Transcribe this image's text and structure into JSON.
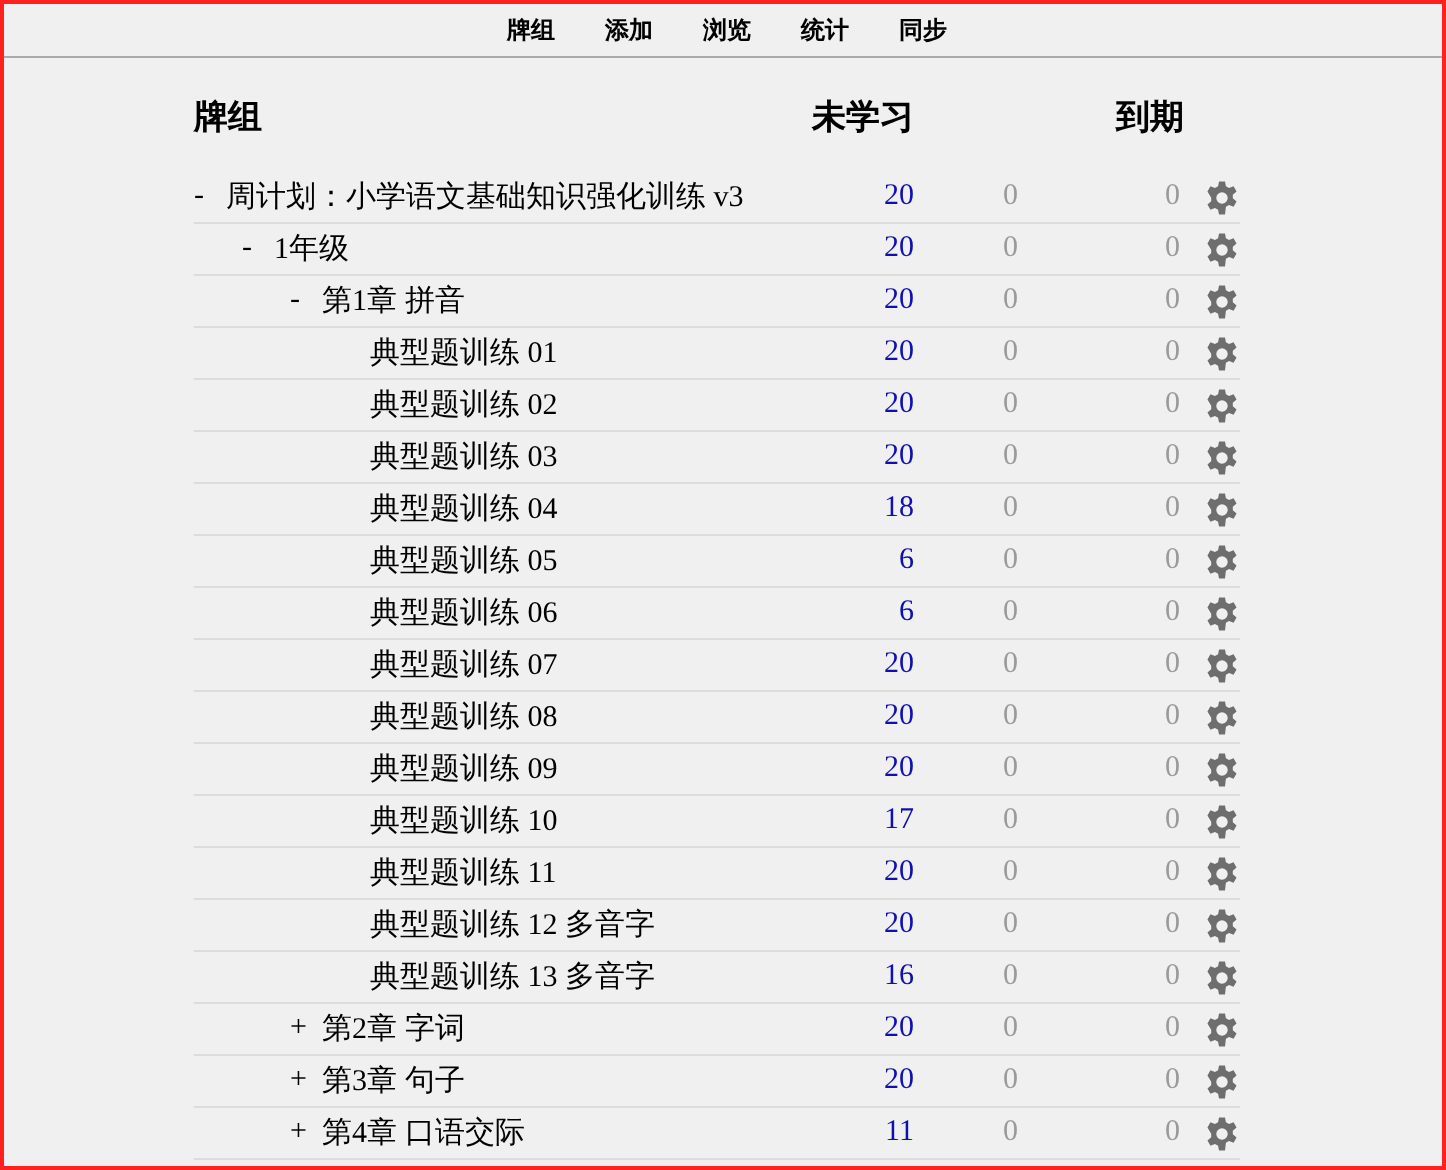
{
  "nav": [
    {
      "label": "牌组"
    },
    {
      "label": "添加"
    },
    {
      "label": "浏览"
    },
    {
      "label": "统计"
    },
    {
      "label": "同步"
    }
  ],
  "columns": {
    "deck": "牌组",
    "new": "未学习",
    "due": "到期"
  },
  "decks": [
    {
      "toggle": "-",
      "name": "周计划：小学语文基础知识强化训练 v3",
      "new": "20",
      "learn": "0",
      "due": "0",
      "children": [
        {
          "toggle": "-",
          "name": "1年级",
          "new": "20",
          "learn": "0",
          "due": "0",
          "children": [
            {
              "toggle": "-",
              "name": "第1章 拼音",
              "new": "20",
              "learn": "0",
              "due": "0",
              "children": [
                {
                  "name": "典型题训练 01",
                  "new": "20",
                  "learn": "0",
                  "due": "0"
                },
                {
                  "name": "典型题训练 02",
                  "new": "20",
                  "learn": "0",
                  "due": "0"
                },
                {
                  "name": "典型题训练 03",
                  "new": "20",
                  "learn": "0",
                  "due": "0"
                },
                {
                  "name": "典型题训练 04",
                  "new": "18",
                  "learn": "0",
                  "due": "0"
                },
                {
                  "name": "典型题训练 05",
                  "new": "6",
                  "learn": "0",
                  "due": "0"
                },
                {
                  "name": "典型题训练 06",
                  "new": "6",
                  "learn": "0",
                  "due": "0"
                },
                {
                  "name": "典型题训练 07",
                  "new": "20",
                  "learn": "0",
                  "due": "0"
                },
                {
                  "name": "典型题训练 08",
                  "new": "20",
                  "learn": "0",
                  "due": "0"
                },
                {
                  "name": "典型题训练 09",
                  "new": "20",
                  "learn": "0",
                  "due": "0"
                },
                {
                  "name": "典型题训练 10",
                  "new": "17",
                  "learn": "0",
                  "due": "0"
                },
                {
                  "name": "典型题训练 11",
                  "new": "20",
                  "learn": "0",
                  "due": "0"
                },
                {
                  "name": "典型题训练 12 多音字",
                  "new": "20",
                  "learn": "0",
                  "due": "0"
                },
                {
                  "name": "典型题训练 13 多音字",
                  "new": "16",
                  "learn": "0",
                  "due": "0"
                }
              ]
            },
            {
              "toggle": "+",
              "name": "第2章 字词",
              "new": "20",
              "learn": "0",
              "due": "0"
            },
            {
              "toggle": "+",
              "name": "第3章 句子",
              "new": "20",
              "learn": "0",
              "due": "0"
            },
            {
              "toggle": "+",
              "name": "第4章 口语交际",
              "new": "11",
              "learn": "0",
              "due": "0"
            }
          ]
        }
      ]
    }
  ]
}
